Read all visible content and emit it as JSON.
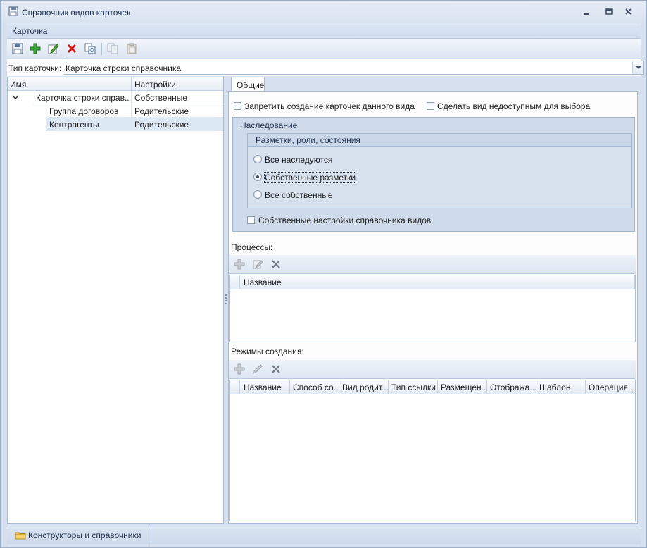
{
  "window": {
    "title": "Справочник видов карточек"
  },
  "menu": {
    "items": [
      {
        "label": "Карточка"
      }
    ]
  },
  "toolbar": {
    "buttons": [
      {
        "icon": "save-icon"
      },
      {
        "icon": "add-icon"
      },
      {
        "icon": "edit-icon"
      },
      {
        "icon": "delete-icon"
      },
      {
        "icon": "duplicate-icon"
      },
      {
        "icon": "copy-icon"
      },
      {
        "icon": "paste-icon"
      }
    ]
  },
  "card_type": {
    "label": "Тип карточки:",
    "value": "Карточка строки справочника"
  },
  "tree": {
    "columns": [
      "Имя",
      "Настройки"
    ],
    "rows": [
      {
        "name": "Карточка строки справ...",
        "setting": "Собственные",
        "level": 0,
        "expanded": true
      },
      {
        "name": "Группа договоров",
        "setting": "Родительские",
        "level": 1
      },
      {
        "name": "Контрагенты",
        "setting": "Родительские",
        "level": 1,
        "selected": true
      }
    ]
  },
  "tabs": [
    {
      "label": "Общие",
      "active": true
    }
  ],
  "general": {
    "forbid_creation_label": "Запретить создание карточек данного вида",
    "forbid_creation_checked": false,
    "unavailable_label": "Сделать вид недоступным для выбора",
    "unavailable_checked": false,
    "inheritance": {
      "title": "Наследование",
      "markup_group_title": "Разметки, роли, состояния",
      "options": [
        {
          "label": "Все наследуются",
          "selected": false
        },
        {
          "label": "Собственные разметки",
          "selected": true
        },
        {
          "label": "Все собственные",
          "selected": false
        }
      ],
      "own_settings_label": "Собственные настройки справочника видов",
      "own_settings_checked": false
    },
    "processes": {
      "label": "Процессы:",
      "columns": [
        "Название"
      ]
    },
    "creation_modes": {
      "label": "Режимы создания:",
      "columns": [
        "Название",
        "Способ со...",
        "Вид родит...",
        "Тип ссылки",
        "Размещен...",
        "Отобража...",
        "Шаблон",
        "Операция ..."
      ]
    }
  },
  "statusbar": {
    "item_label": "Конструкторы и справочники"
  }
}
